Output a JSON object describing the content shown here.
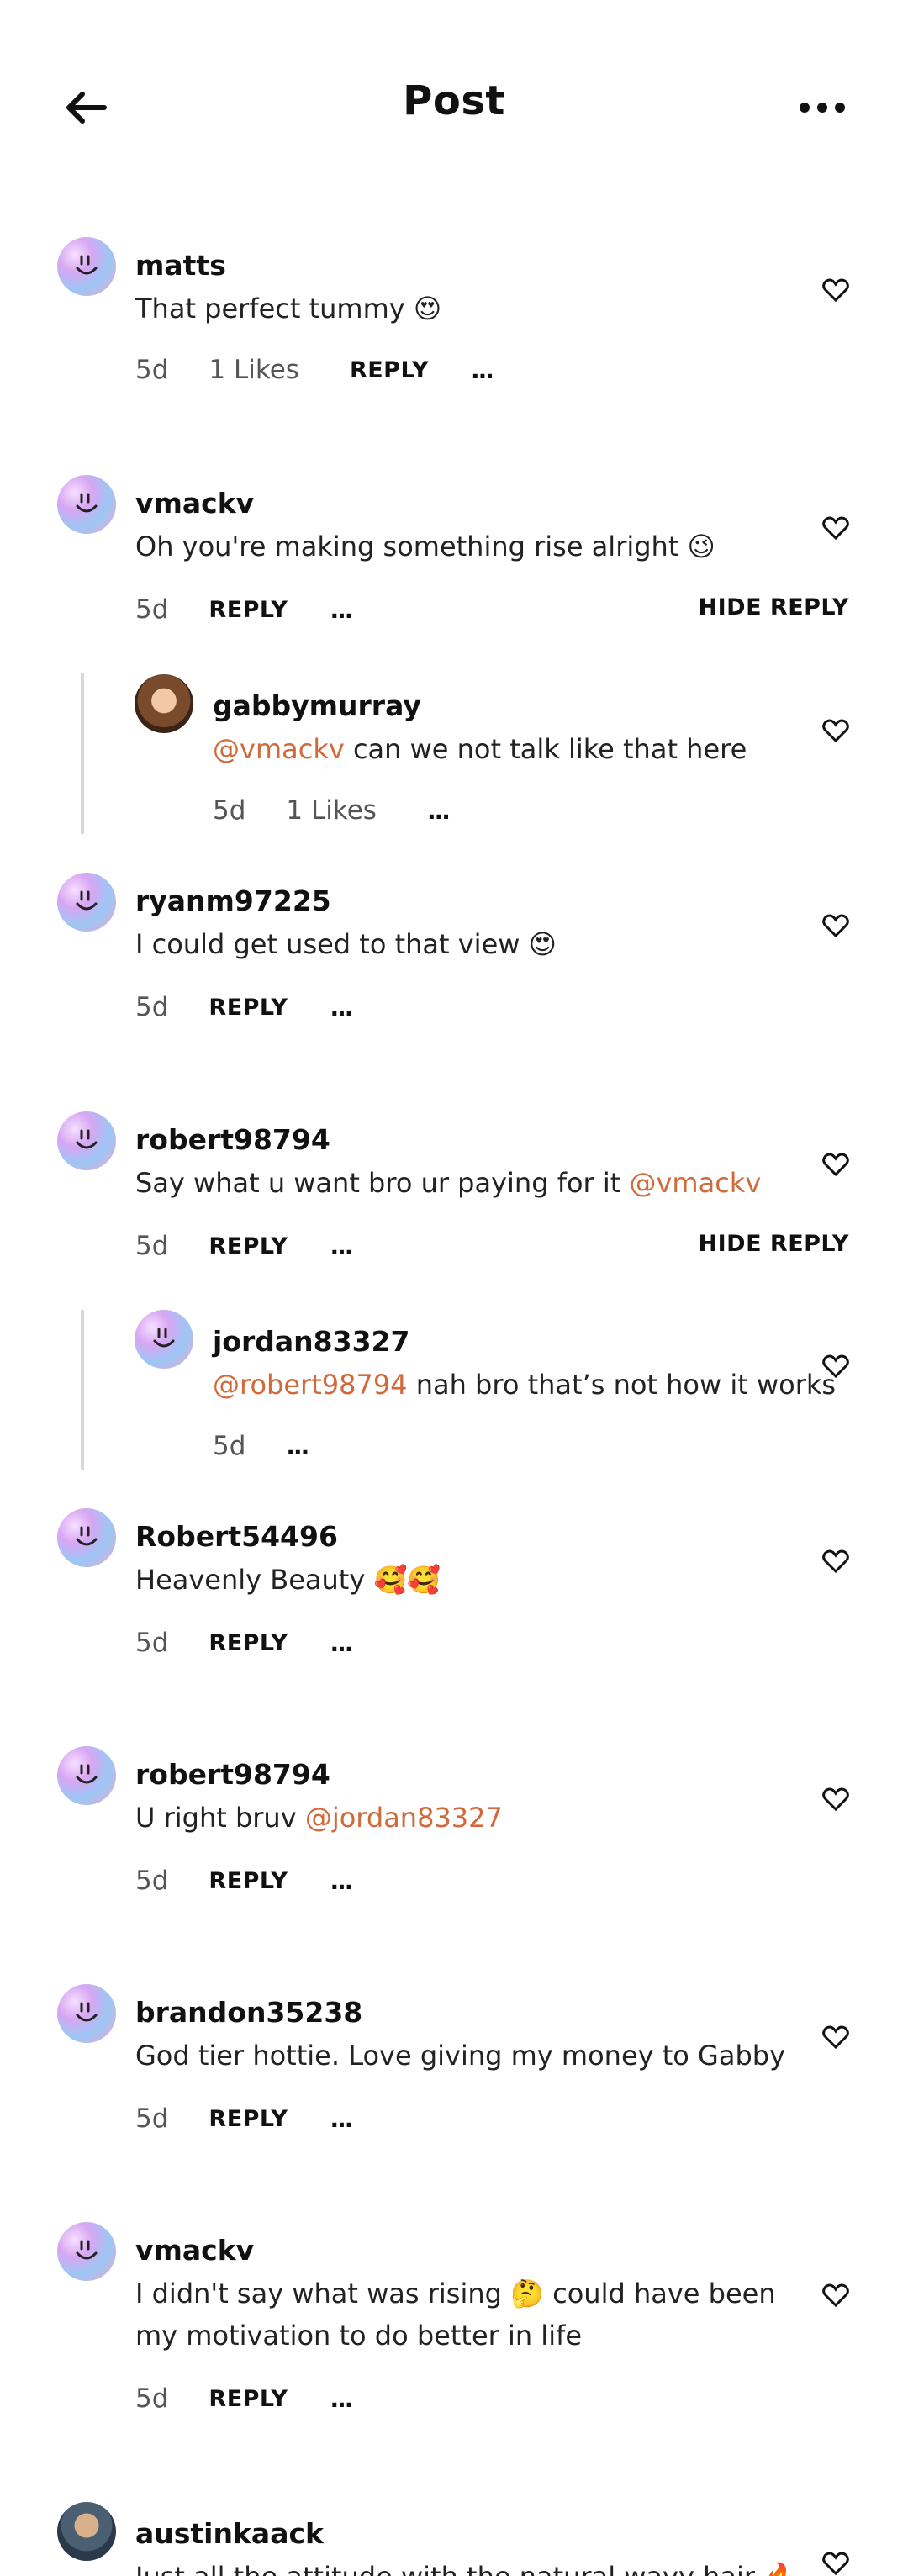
{
  "header": {
    "title": "Post"
  },
  "icons": {
    "back": "arrow-left-icon",
    "more": "more-horizontal-icon",
    "like": "heart-icon"
  },
  "colors": {
    "mention": "#d06a3a",
    "thread_line": "#d8d8d8"
  },
  "labels": {
    "reply": "REPLY",
    "hide_reply": "HIDE REPLY",
    "more": "..."
  },
  "comments": [
    {
      "username": "matts",
      "text": "That perfect tummy 😍",
      "time": "5d",
      "likes": "1 Likes"
    },
    {
      "username": "vmackv",
      "text": "Oh you're making something rise alright 😉",
      "time": "5d"
    },
    {
      "username": "gabbymurray",
      "mention": "@vmackv",
      "text": " can we not talk like that here",
      "time": "5d",
      "likes": "1 Likes"
    },
    {
      "username": "ryanm97225",
      "text": "I could get used to that view 😍",
      "time": "5d"
    },
    {
      "username": "robert98794",
      "text": "Say what u want bro ur paying for it ",
      "mention": "@vmackv",
      "time": "5d"
    },
    {
      "username": "jordan83327",
      "mention": "@robert98794",
      "text": " nah bro that’s not how it works",
      "time": "5d"
    },
    {
      "username": "Robert54496",
      "text": "Heavenly Beauty 🥰🥰",
      "time": "5d"
    },
    {
      "username": "robert98794",
      "text": "U right bruv ",
      "mention": "@jordan83327",
      "time": "5d"
    },
    {
      "username": "brandon35238",
      "text": "God tier hottie. Love giving my money to Gabby",
      "time": "5d"
    },
    {
      "username": "vmackv",
      "text": "I didn't say what was rising 🤔 could have been my motivation to do better in life",
      "time": "5d"
    },
    {
      "username": "austinkaack",
      "text": "Just all the attitude with the natural wavy hair 🔥"
    }
  ]
}
